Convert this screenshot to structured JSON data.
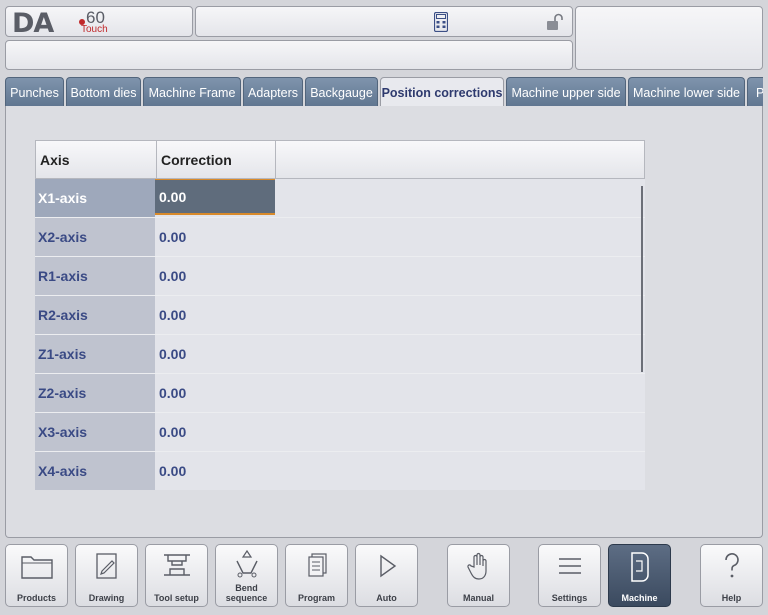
{
  "brand": {
    "logo": "DA",
    "model": "60",
    "sub": "Touch"
  },
  "tabs": [
    "Punches",
    "Bottom dies",
    "Machine Frame",
    "Adapters",
    "Backgauge",
    "Position corrections",
    "Machine upper side",
    "Machine lower side",
    "P"
  ],
  "active_tab": "Position corrections",
  "table": {
    "headers": [
      "Axis",
      "Correction"
    ],
    "rows": [
      {
        "axis": "X1-axis",
        "value": "0.00"
      },
      {
        "axis": "X2-axis",
        "value": "0.00"
      },
      {
        "axis": "R1-axis",
        "value": "0.00"
      },
      {
        "axis": "R2-axis",
        "value": "0.00"
      },
      {
        "axis": "Z1-axis",
        "value": "0.00"
      },
      {
        "axis": "Z2-axis",
        "value": "0.00"
      },
      {
        "axis": "X3-axis",
        "value": "0.00"
      },
      {
        "axis": "X4-axis",
        "value": "0.00"
      }
    ],
    "selected_row": 0
  },
  "nav": [
    {
      "label": "Products",
      "icon": "folder-icon"
    },
    {
      "label": "Drawing",
      "icon": "pencil-icon"
    },
    {
      "label": "Tool setup",
      "icon": "tool-setup-icon"
    },
    {
      "label": "Bend\nsequence",
      "icon": "bend-sequence-icon"
    },
    {
      "label": "Program",
      "icon": "pages-icon"
    },
    {
      "label": "Auto",
      "icon": "play-icon"
    },
    {
      "label": "Manual",
      "icon": "hand-icon"
    },
    {
      "label": "Settings",
      "icon": "list-icon"
    },
    {
      "label": "Machine",
      "icon": "machine-icon"
    },
    {
      "label": "Help",
      "icon": "question-icon"
    }
  ],
  "active_nav": "Machine",
  "colors": {
    "accent": "#d98a2a",
    "tab": "#6f849e",
    "active_nav": "#4a5a70"
  }
}
